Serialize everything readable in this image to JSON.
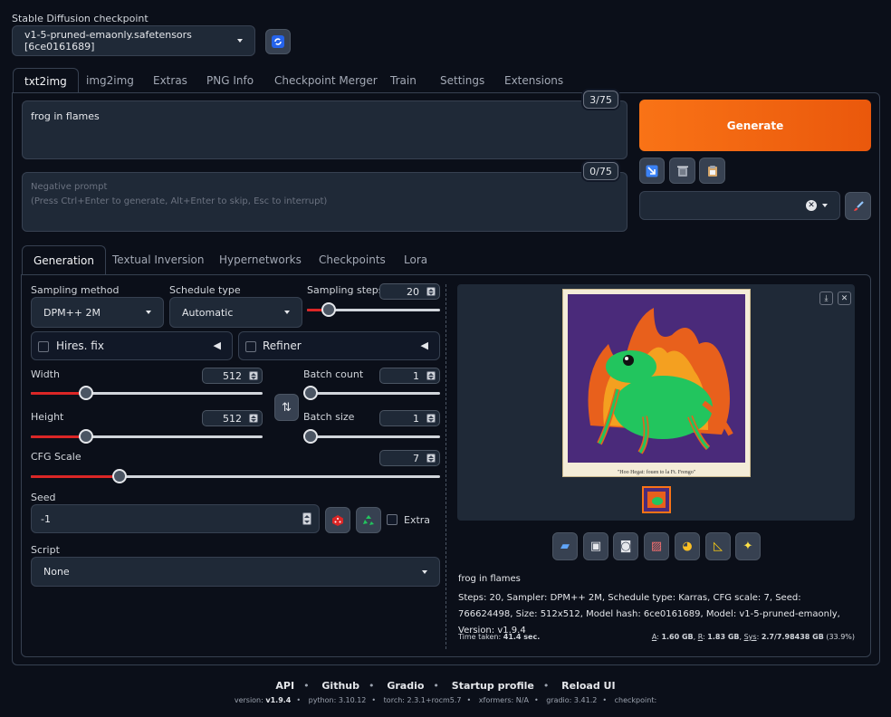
{
  "checkpoint": {
    "label": "Stable Diffusion checkpoint",
    "value": "v1-5-pruned-emaonly.safetensors [6ce0161689]",
    "refresh_icon": "refresh-icon"
  },
  "main_tabs": [
    {
      "label": "txt2img",
      "active": true
    },
    {
      "label": "img2img"
    },
    {
      "label": "Extras"
    },
    {
      "label": "PNG Info"
    },
    {
      "label": "Checkpoint Merger"
    },
    {
      "label": "Train"
    },
    {
      "label": "Settings"
    },
    {
      "label": "Extensions"
    }
  ],
  "prompt": {
    "value": "frog in flames",
    "counter": "3/75"
  },
  "negative_prompt": {
    "placeholder_line1": "Negative prompt",
    "placeholder_line2": "(Press Ctrl+Enter to generate, Alt+Enter to skip, Esc to interrupt)",
    "counter": "0/75"
  },
  "generate": {
    "label": "Generate",
    "color": "#ea580c"
  },
  "tool_icons": [
    "arrow-in-icon",
    "trash-icon",
    "clipboard-icon"
  ],
  "style_dropdown": {
    "value": "",
    "clear_icon": "close-icon"
  },
  "paint_icon": "brush-icon",
  "sub_tabs": [
    {
      "label": "Generation",
      "active": true
    },
    {
      "label": "Textual Inversion"
    },
    {
      "label": "Hypernetworks"
    },
    {
      "label": "Checkpoints"
    },
    {
      "label": "Lora"
    }
  ],
  "sampling_method": {
    "label": "Sampling method",
    "value": "DPM++ 2M"
  },
  "schedule_type": {
    "label": "Schedule type",
    "value": "Automatic"
  },
  "sampling_steps": {
    "label": "Sampling steps",
    "value": "20",
    "fraction": 0.16
  },
  "hires_fix": {
    "label": "Hires. fix"
  },
  "refiner": {
    "label": "Refiner"
  },
  "width": {
    "label": "Width",
    "value": "512",
    "fraction": 0.24
  },
  "height": {
    "label": "Height",
    "value": "512",
    "fraction": 0.24
  },
  "batch_count": {
    "label": "Batch count",
    "value": "1",
    "fraction": 0.0
  },
  "batch_size": {
    "label": "Batch size",
    "value": "1",
    "fraction": 0.0
  },
  "cfg_scale": {
    "label": "CFG Scale",
    "value": "7",
    "fraction": 0.216
  },
  "seed": {
    "label": "Seed",
    "value": "-1",
    "extra_label": "Extra"
  },
  "script": {
    "label": "Script",
    "value": "None"
  },
  "output": {
    "image_caption": "\"Hoo Hegat: fouen to la Ft. Frengo\"",
    "action_icons": [
      "folder-icon",
      "save-icon",
      "zip-icon",
      "image-icon",
      "palette-icon",
      "ruler-icon",
      "sparkle-icon"
    ],
    "info_prompt": "frog in flames",
    "info_params": "Steps: 20, Sampler: DPM++ 2M, Schedule type: Karras, CFG scale: 7, Seed: 766624498, Size: 512x512, Model hash: 6ce0161689, Model: v1-5-pruned-emaonly, Version: v1.9.4",
    "time_label": "Time taken:",
    "time_value": "41.4 sec.",
    "mem_a_label": "A",
    "mem_a_value": "1.60 GB",
    "mem_r_label": "R",
    "mem_r_value": "1.83 GB",
    "mem_sys_label": "Sys",
    "mem_sys_value": "2.7/7.98438 GB",
    "mem_sys_pct": "(33.9%)"
  },
  "footer": {
    "links": [
      "API",
      "Github",
      "Gradio",
      "Startup profile",
      "Reload UI"
    ],
    "version_label": "version:",
    "version_value": "v1.9.4",
    "python": "python: 3.10.12",
    "torch": "torch: 2.3.1+rocm5.7",
    "xformers": "xformers: N/A",
    "gradio": "gradio: 3.41.2",
    "checkpoint": "checkpoint:"
  }
}
